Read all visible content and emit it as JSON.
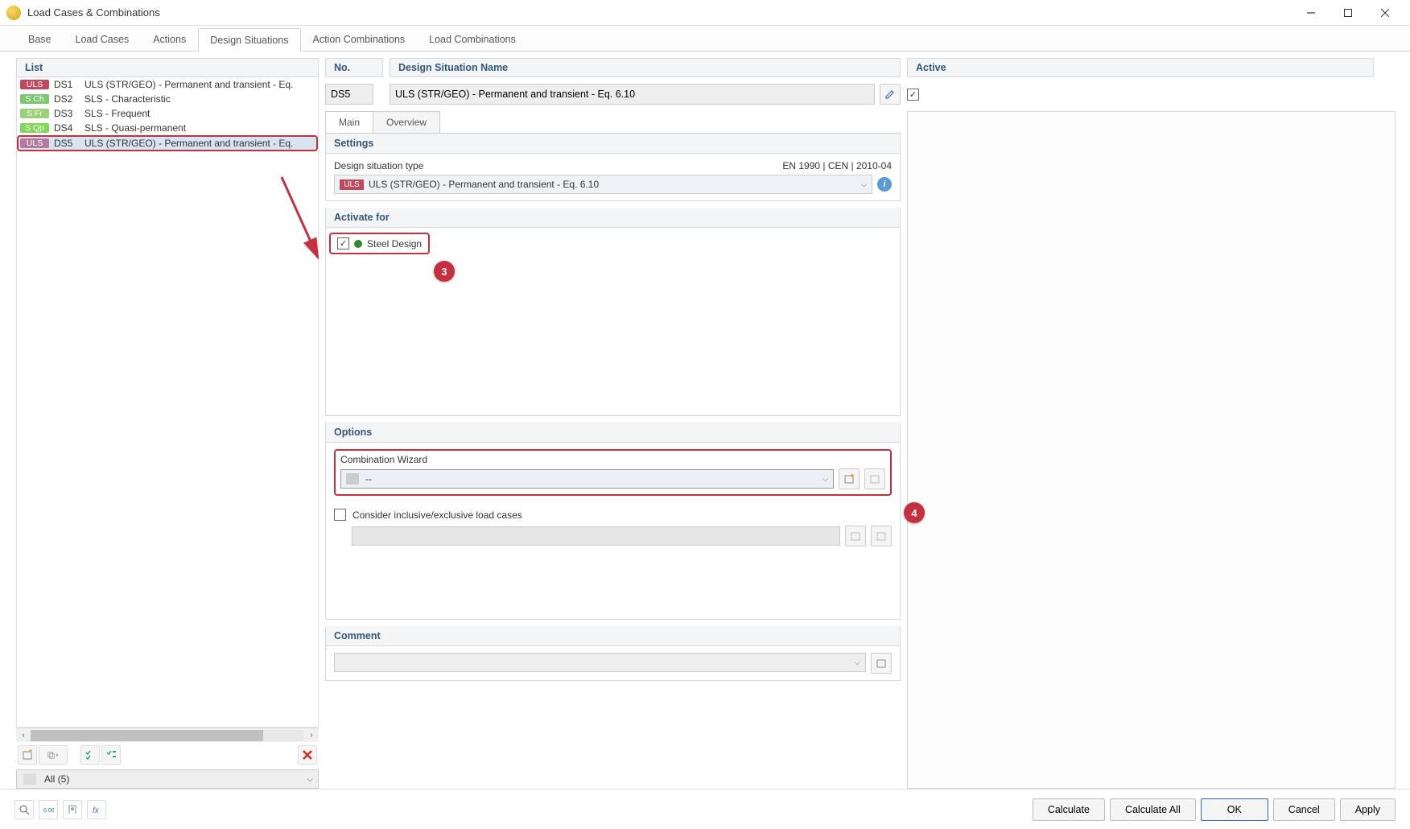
{
  "window": {
    "title": "Load Cases & Combinations"
  },
  "tabs": {
    "items": [
      "Base",
      "Load Cases",
      "Actions",
      "Design Situations",
      "Action Combinations",
      "Load Combinations"
    ],
    "active_index": 3
  },
  "list": {
    "header": "List",
    "items": [
      {
        "badge": "ULS",
        "badge_class": "ULS",
        "ds": "DS1",
        "desc": "ULS (STR/GEO) - Permanent and transient - Eq."
      },
      {
        "badge": "S Ch",
        "badge_class": "SCh",
        "ds": "DS2",
        "desc": "SLS - Characteristic"
      },
      {
        "badge": "S Fr",
        "badge_class": "SFr",
        "ds": "DS3",
        "desc": "SLS - Frequent"
      },
      {
        "badge": "S Qp",
        "badge_class": "SOp",
        "ds": "DS4",
        "desc": "SLS - Quasi-permanent"
      },
      {
        "badge": "ULS",
        "badge_class": "ULS",
        "ds": "DS5",
        "desc": "ULS (STR/GEO) - Permanent and transient - Eq."
      }
    ],
    "selected_index": 4,
    "filter": "All (5)"
  },
  "header": {
    "no": "No.",
    "name": "Design Situation Name",
    "active": "Active"
  },
  "values": {
    "no": "DS5",
    "name": "ULS (STR/GEO) - Permanent and transient - Eq. 6.10",
    "active_checked": true
  },
  "sub_tabs": {
    "items": [
      "Main",
      "Overview"
    ],
    "active_index": 0
  },
  "settings": {
    "header": "Settings",
    "type_label": "Design situation type",
    "type_standard": "EN 1990 | CEN | 2010-04",
    "type_value": "ULS (STR/GEO) - Permanent and transient - Eq. 6.10",
    "type_badge": "ULS"
  },
  "activate": {
    "header": "Activate for",
    "item": "Steel Design"
  },
  "options": {
    "header": "Options",
    "wizard_label": "Combination Wizard",
    "wizard_value": "--",
    "consider_label": "Consider inclusive/exclusive load cases"
  },
  "comment": {
    "header": "Comment"
  },
  "footer": {
    "calculate": "Calculate",
    "calculate_all": "Calculate All",
    "ok": "OK",
    "cancel": "Cancel",
    "apply": "Apply"
  },
  "callouts": {
    "c3": "3",
    "c4": "4"
  }
}
